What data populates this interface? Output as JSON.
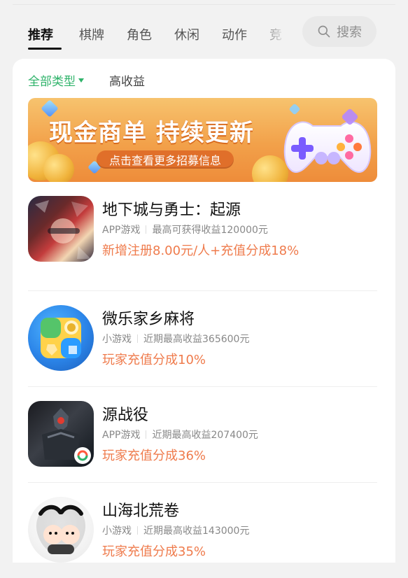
{
  "tabs": [
    {
      "label": "推荐",
      "active": true
    },
    {
      "label": "棋牌",
      "active": false
    },
    {
      "label": "角色",
      "active": false
    },
    {
      "label": "休闲",
      "active": false
    },
    {
      "label": "动作",
      "active": false
    },
    {
      "label": "竞",
      "active": false
    }
  ],
  "search": {
    "label": "搜索",
    "icon": "search-icon"
  },
  "filters": [
    {
      "label": "全部类型",
      "active": true,
      "has_caret": true
    },
    {
      "label": "高收益",
      "active": false,
      "has_caret": false
    }
  ],
  "banner": {
    "title": "现金商单 持续更新",
    "cta": "点击查看更多招募信息"
  },
  "games": [
    {
      "name": "地下城与勇士：起源",
      "type": "APP游戏",
      "earning": "最高可获得收益120000元",
      "reward": "新增注册8.00元/人+充值分成18%",
      "icon": "anime-hero-icon"
    },
    {
      "name": "微乐家乡麻将",
      "type": "小游戏",
      "earning": "近期最高收益365600元",
      "reward": "玩家充值分成10%",
      "icon": "mahjong-dice-icon"
    },
    {
      "name": "源战役",
      "type": "APP游戏",
      "earning": "近期最高收益207400元",
      "reward": "玩家充值分成36%",
      "icon": "armored-warrior-icon"
    },
    {
      "name": "山海北荒卷",
      "type": "小游戏",
      "earning": "近期最高收益143000元",
      "reward": "玩家充值分成35%",
      "icon": "ink-characters-icon"
    }
  ],
  "colors": {
    "accent_green": "#2fb36a",
    "reward_orange": "#ef7b4c",
    "banner_orange": "#f2a14a"
  }
}
